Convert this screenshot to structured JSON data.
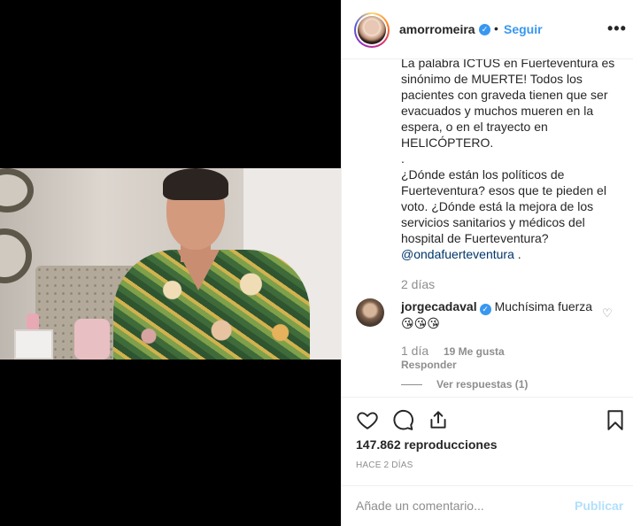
{
  "header": {
    "username": "amorromeira",
    "separator": "•",
    "follow_label": "Seguir",
    "more_label": "•••"
  },
  "caption": {
    "text": "La palabra ICTUS en Fuerteventura es sinónimo de MUERTE! Todos los pacientes con graveda tienen que ser evacuados y muchos mueren en la espera, o en el trayecto en HELICÓPTERO.\n.\n¿Dónde están los políticos de Fuerteventura? esos que te pieden el voto. ¿Dónde está la mejora de los servicios sanitarios y médicos del hospital de Fuerteventura?",
    "mention": "@ondafuerteventura",
    "trailing": " .",
    "time": "2 días"
  },
  "comment": {
    "username": "jorgecadaval",
    "text": "Muchísima fuerza 😘😘😘",
    "time": "1 día",
    "likes": "19 Me gusta",
    "reply_label": "Responder",
    "view_replies": "Ver respuestas (1)"
  },
  "actions": {
    "views": "147.862 reproducciones",
    "posted_ago": "HACE 2 DÍAS",
    "icons": [
      "heart-icon",
      "comment-icon",
      "share-icon",
      "bookmark-icon"
    ]
  },
  "add_comment": {
    "placeholder": "Añade un comentario...",
    "publish_label": "Publicar"
  },
  "colors": {
    "link_blue": "#3897f0",
    "mention_blue": "#003569",
    "muted": "#8e8e8e",
    "publish_disabled": "#b2dffc"
  }
}
